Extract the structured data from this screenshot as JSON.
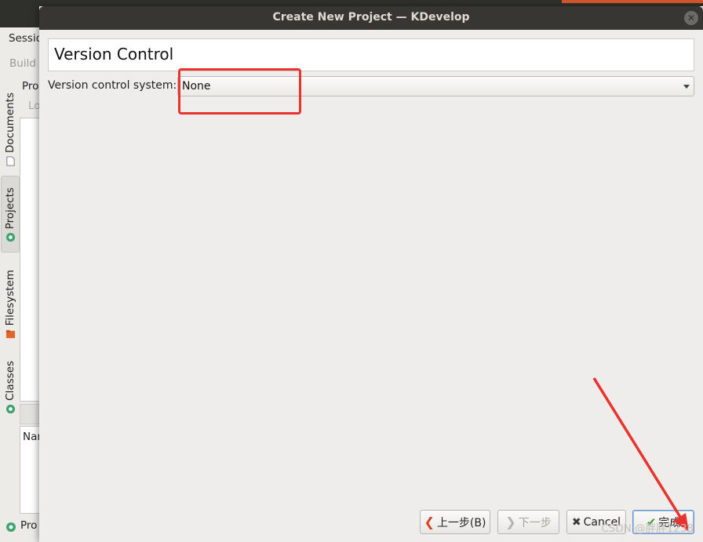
{
  "background_window": {
    "menu_item": "Sessio",
    "toolbar_item": "Build",
    "side_tabs": [
      "Documents",
      "Projects",
      "Filesystem",
      "Classes"
    ],
    "panel_header": "Pro",
    "panel_sub": "Lo",
    "list_header": "Nar",
    "status_label": "Pro"
  },
  "dialog": {
    "title": "Create New Project — KDevelop",
    "close_icon": "close-icon",
    "page_title": "Version Control",
    "vcs_label": "Version control system:",
    "vcs_value": "None",
    "buttons": {
      "back": "上一步(B)",
      "next": "下一步",
      "cancel": "Cancel",
      "finish": "完成"
    }
  },
  "annotations": {
    "highlight_color": "#e8332f",
    "arrow_color": "#e8332f"
  },
  "watermark": "CSDN @胖胖1238"
}
